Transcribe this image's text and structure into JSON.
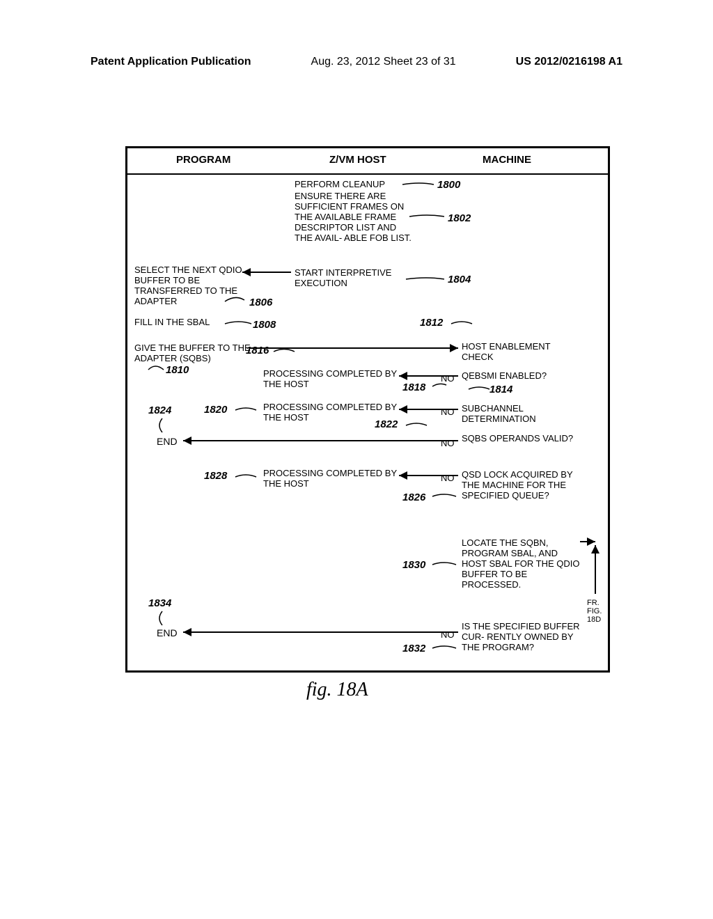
{
  "header": {
    "left": "Patent Application Publication",
    "mid": "Aug. 23, 2012   Sheet 23 of 31",
    "right": "US 2012/0216198 A1"
  },
  "columns": {
    "program": "PROGRAM",
    "host": "Z/VM HOST",
    "machine": "MACHINE"
  },
  "caption": "fig. 18A",
  "refs": {
    "r1800": "1800",
    "r1802": "1802",
    "r1804": "1804",
    "r1806": "1806",
    "r1808": "1808",
    "r1810": "1810",
    "r1812": "1812",
    "r1814": "1814",
    "r1816": "1816",
    "r1818": "1818",
    "r1820": "1820",
    "r1822": "1822",
    "r1824": "1824",
    "r1826": "1826",
    "r1828": "1828",
    "r1830": "1830",
    "r1832": "1832",
    "r1834": "1834"
  },
  "labels": {
    "no": "NO",
    "end": "END",
    "fr_fig_18d": "FR. FIG. 18D"
  },
  "blocks": {
    "cleanup": "PERFORM CLEANUP",
    "ensure": "ENSURE THERE ARE SUFFICIENT FRAMES ON THE AVAILABLE FRAME DESCRIPTOR LIST AND THE AVAIL- ABLE FOB LIST.",
    "start_exec": "START INTERPRETIVE EXECUTION",
    "select_next": "SELECT THE NEXT QDIO BUFFER TO BE TRANSFERRED TO THE ADAPTER",
    "fill_sbal": "FILL IN THE SBAL",
    "give_buffer": "GIVE THE BUFFER TO THE ADAPTER (SQBS)",
    "host_enable": "HOST ENABLEMENT CHECK",
    "qebsmi": "QEBSMI ENABLED?",
    "proc_completed": "PROCESSING COMPLETED BY THE HOST",
    "subchannel": "SUBCHANNEL DETERMINATION",
    "sqbs_operands": "SQBS OPERANDS VALID?",
    "qsd_lock": "QSD LOCK ACQUIRED BY THE MACHINE FOR THE SPECIFIED QUEUE?",
    "locate_sqbn": "LOCATE THE SQBN, PROGRAM SBAL, AND HOST SBAL FOR THE QDIO BUFFER TO BE PROCESSED.",
    "buffer_owned": "IS THE SPECIFIED BUFFER CUR- RENTLY OWNED BY THE PROGRAM?"
  }
}
